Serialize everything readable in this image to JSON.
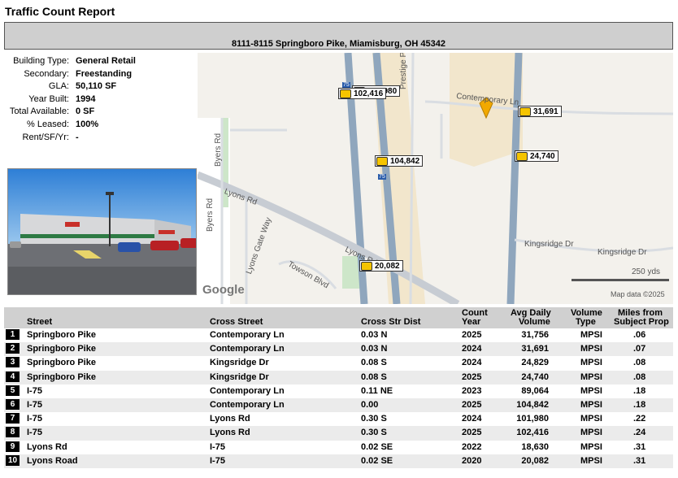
{
  "title": "Traffic Count Report",
  "address": "8111-8115 Springboro Pike, Miamisburg, OH 45342",
  "info": [
    {
      "label": "Building Type:",
      "value": "General Retail"
    },
    {
      "label": "Secondary:",
      "value": "Freestanding"
    },
    {
      "label": "GLA:",
      "value": "50,110 SF"
    },
    {
      "label": "Year Built:",
      "value": "1994"
    },
    {
      "label": "Total Available:",
      "value": "0 SF"
    },
    {
      "label": "% Leased:",
      "value": "100%"
    },
    {
      "label": "Rent/SF/Yr:",
      "value": "-"
    }
  ],
  "map": {
    "labels": {
      "contemporary": "Contemporary Ln",
      "prestige": "Prestige Pl",
      "byers1": "Byers Rd",
      "byers2": "Byers Rd",
      "lyons": "Lyons Rd",
      "lyonsgate": "Lyons Gate Way",
      "towson": "Towson Blvd",
      "lyons2": "Lyons Rd",
      "kings1": "Kingsridge Dr",
      "kings2": "Kingsridge Dr",
      "scale": "250 yds",
      "google": "Google",
      "mapdata": "Map data ©2025",
      "shield1": "75",
      "shield2": "75"
    },
    "markers": {
      "m1": "102,416",
      "m1b": "101,980",
      "m2": "31,691",
      "m3": "24,740",
      "m4": "104,842",
      "m5": "20,082"
    }
  },
  "table": {
    "headers": {
      "street": "Street",
      "cross": "Cross Street",
      "dist": "Cross Str Dist",
      "count1": "Count",
      "count2": "Year",
      "avg1": "Avg Daily",
      "avg2": "Volume",
      "vol1": "Volume",
      "vol2": "Type",
      "miles1": "Miles from",
      "miles2": "Subject Prop"
    },
    "rows": [
      {
        "n": "1",
        "street": "Springboro Pike",
        "cross": "Contemporary Ln",
        "dist": "0.03 N",
        "year": "2025",
        "volume": "31,756",
        "type": "MPSI",
        "miles": ".06"
      },
      {
        "n": "2",
        "street": "Springboro Pike",
        "cross": "Contemporary Ln",
        "dist": "0.03 N",
        "year": "2024",
        "volume": "31,691",
        "type": "MPSI",
        "miles": ".07"
      },
      {
        "n": "3",
        "street": "Springboro Pike",
        "cross": "Kingsridge Dr",
        "dist": "0.08 S",
        "year": "2024",
        "volume": "24,829",
        "type": "MPSI",
        "miles": ".08"
      },
      {
        "n": "4",
        "street": "Springboro Pike",
        "cross": "Kingsridge Dr",
        "dist": "0.08 S",
        "year": "2025",
        "volume": "24,740",
        "type": "MPSI",
        "miles": ".08"
      },
      {
        "n": "5",
        "street": "I-75",
        "cross": "Contemporary Ln",
        "dist": "0.11 NE",
        "year": "2023",
        "volume": "89,064",
        "type": "MPSI",
        "miles": ".18"
      },
      {
        "n": "6",
        "street": "I-75",
        "cross": "Contemporary Ln",
        "dist": "0.00",
        "year": "2025",
        "volume": "104,842",
        "type": "MPSI",
        "miles": ".18"
      },
      {
        "n": "7",
        "street": "I-75",
        "cross": "Lyons Rd",
        "dist": "0.30 S",
        "year": "2024",
        "volume": "101,980",
        "type": "MPSI",
        "miles": ".22"
      },
      {
        "n": "8",
        "street": "I-75",
        "cross": "Lyons Rd",
        "dist": "0.30 S",
        "year": "2025",
        "volume": "102,416",
        "type": "MPSI",
        "miles": ".24"
      },
      {
        "n": "9",
        "street": "Lyons Rd",
        "cross": "I-75",
        "dist": "0.02 SE",
        "year": "2022",
        "volume": "18,630",
        "type": "MPSI",
        "miles": ".31"
      },
      {
        "n": "10",
        "street": "Lyons Road",
        "cross": "I-75",
        "dist": "0.02 SE",
        "year": "2020",
        "volume": "20,082",
        "type": "MPSI",
        "miles": ".31"
      }
    ]
  }
}
